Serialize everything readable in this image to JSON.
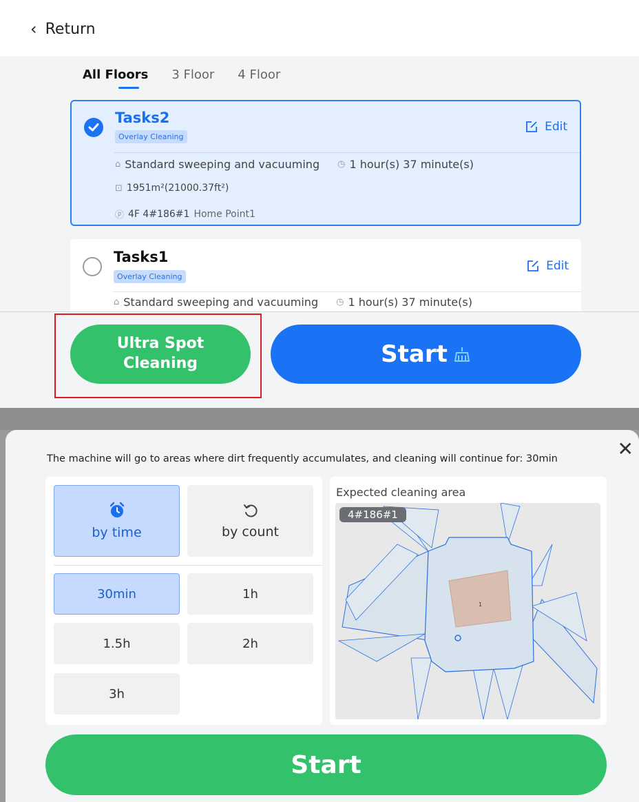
{
  "header": {
    "return_label": "Return"
  },
  "floor_tabs": [
    {
      "label": "All Floors",
      "active": true
    },
    {
      "label": "3 Floor",
      "active": false
    },
    {
      "label": "4 Floor",
      "active": false
    }
  ],
  "tasks": [
    {
      "name": "Tasks2",
      "selected": true,
      "mode": "Overlay Cleaning",
      "edit_label": "Edit",
      "cleaning_type": "Standard sweeping and vacuuming",
      "duration": "1 hour(s) 37 minute(s)",
      "area": "1951m²(21000.37ft²)",
      "point_code": "4F 4#186#1",
      "point_name": "Home Point1"
    },
    {
      "name": "Tasks1",
      "selected": false,
      "mode": "Overlay Cleaning",
      "edit_label": "Edit",
      "cleaning_type": "Standard sweeping and vacuuming",
      "duration": "1 hour(s) 37 minute(s)"
    }
  ],
  "actions": {
    "ultra_spot_line1": "Ultra Spot",
    "ultra_spot_line2": "Cleaning",
    "start_label": "Start"
  },
  "sheet": {
    "description": "The machine will go to areas where dirt frequently accumulates, and cleaning will continue for: 30min",
    "modes": [
      {
        "label": "by time",
        "icon": "alarm-clock-icon",
        "selected": true
      },
      {
        "label": "by count",
        "icon": "refresh-icon",
        "selected": false
      }
    ],
    "durations": [
      {
        "label": "30min",
        "selected": true
      },
      {
        "label": "1h",
        "selected": false
      },
      {
        "label": "1.5h",
        "selected": false
      },
      {
        "label": "2h",
        "selected": false
      },
      {
        "label": "3h",
        "selected": false
      }
    ],
    "map_title": "Expected cleaning area",
    "map_label": "4#186#1",
    "map_zone_label": "1",
    "start_label": "Start"
  },
  "colors": {
    "primary_blue": "#1a73f5",
    "green": "#34c16b",
    "highlight_red": "#e11b22"
  }
}
